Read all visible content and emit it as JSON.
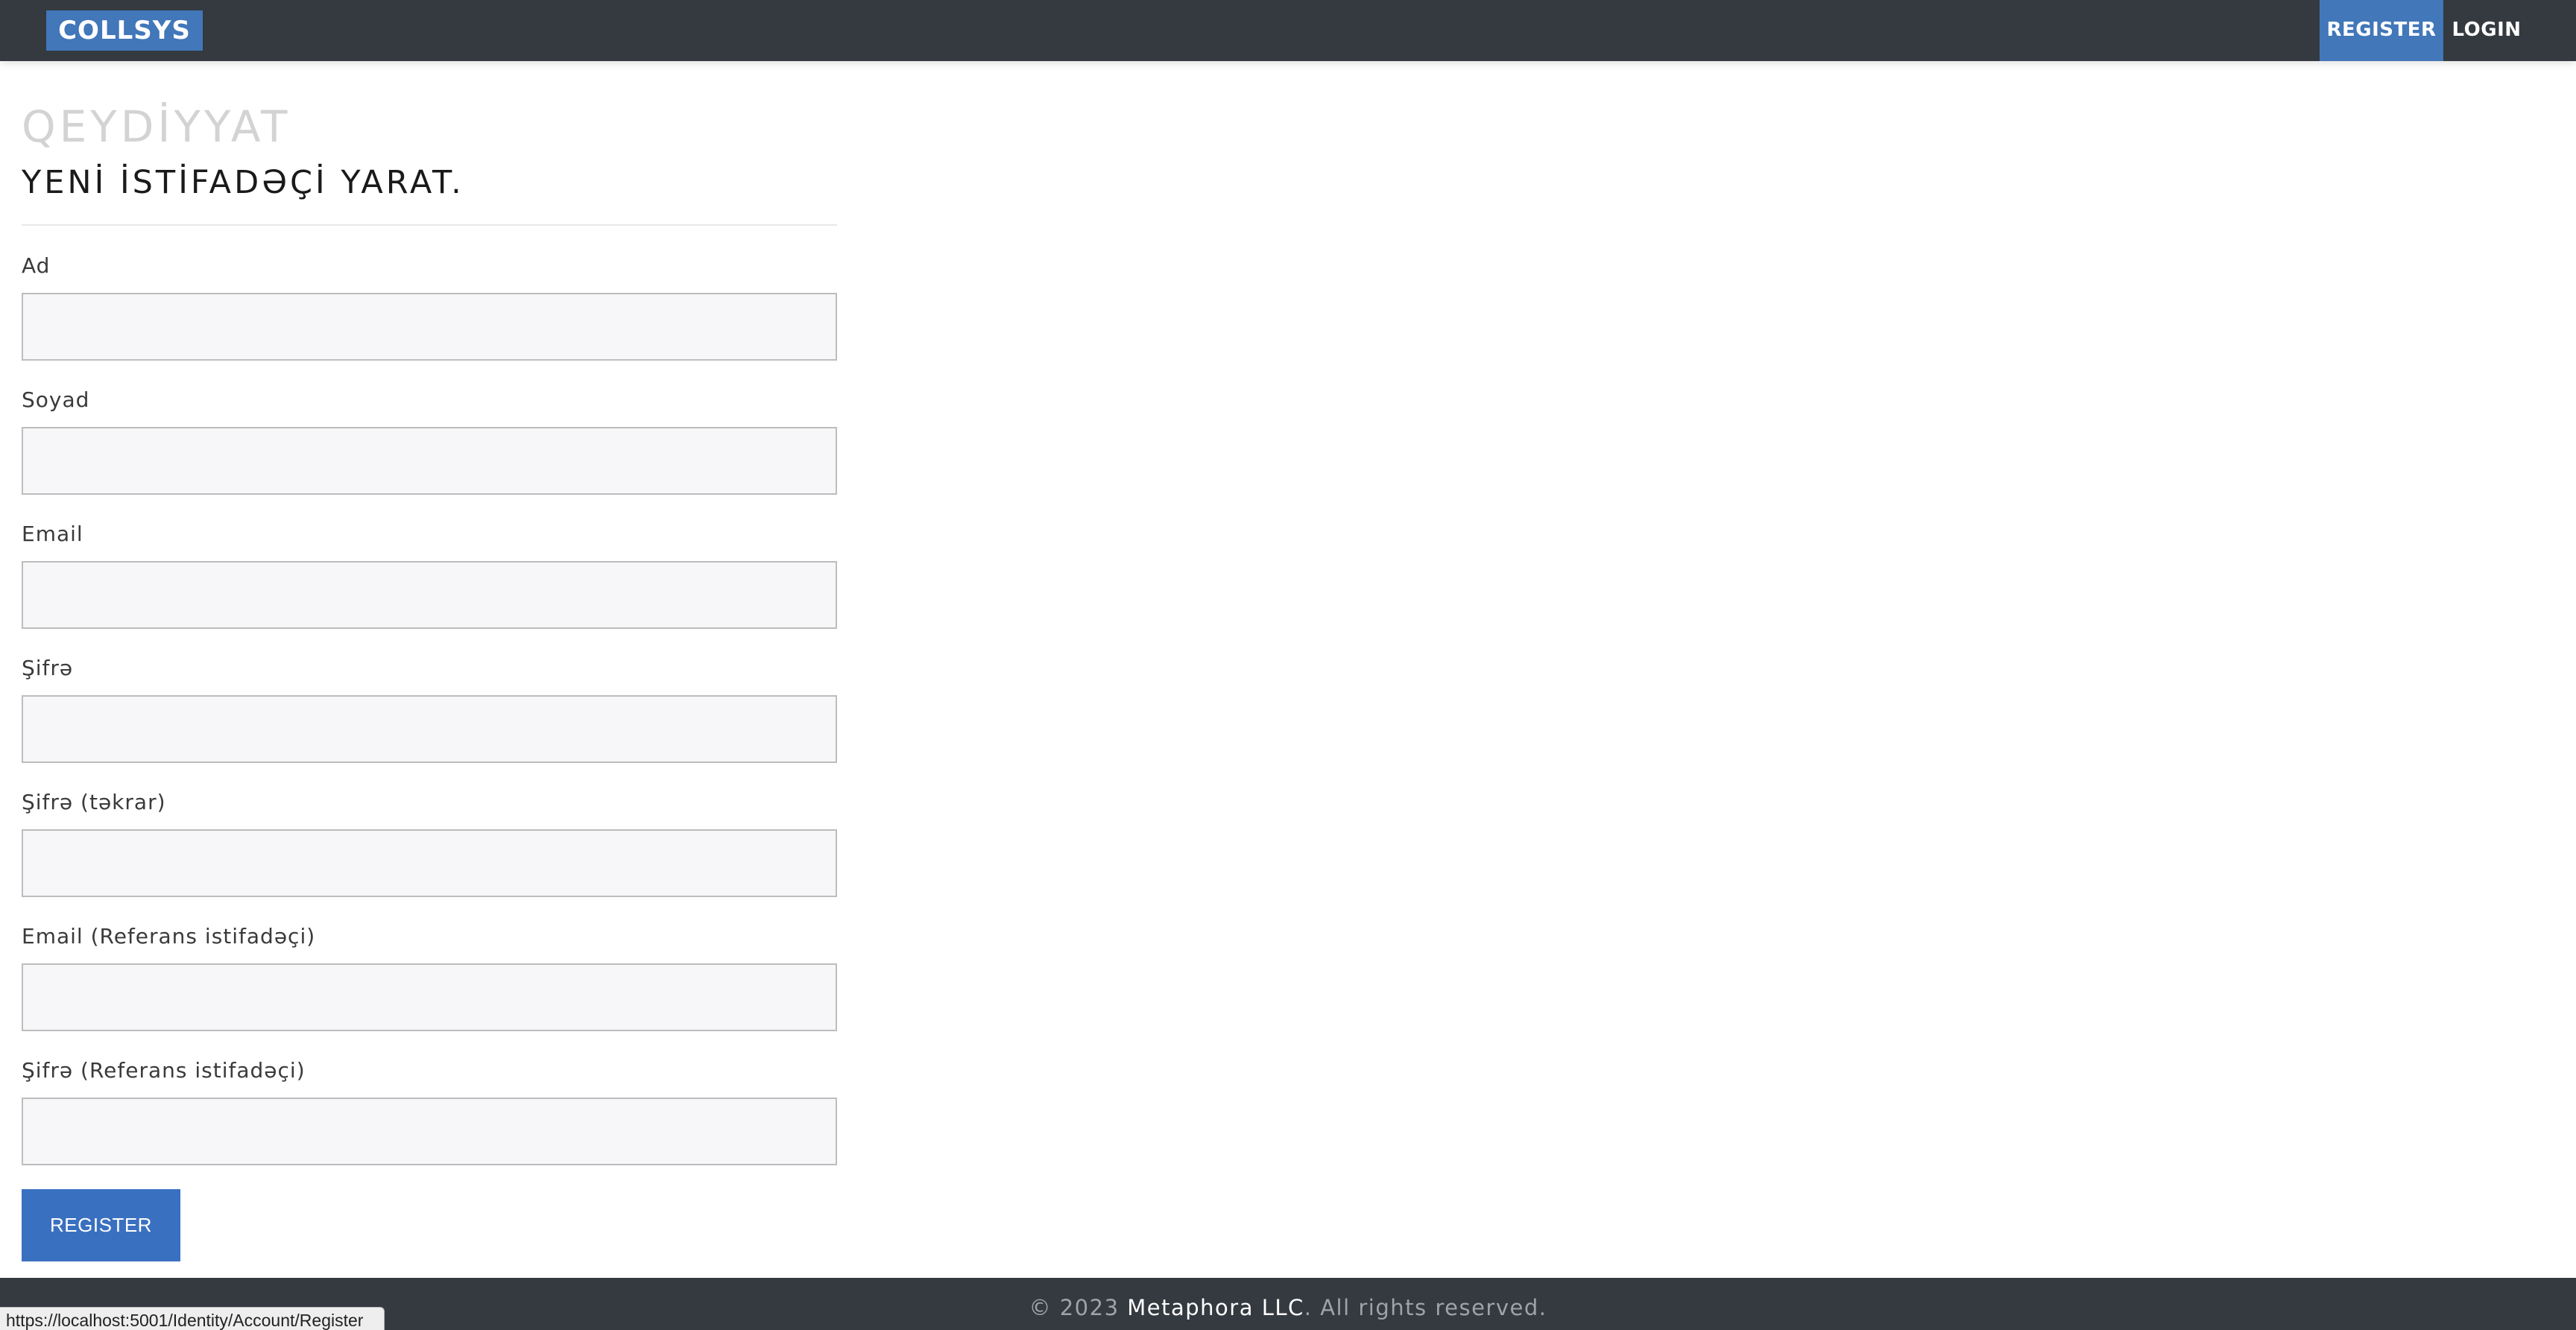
{
  "navbar": {
    "brand": "COLLSYS",
    "links": {
      "register": "REGISTER",
      "login": "LOGIN"
    }
  },
  "page": {
    "title": "QEYDİYYAT",
    "subtitle": "YENİ İSTİFADƏÇİ YARAT."
  },
  "form": {
    "fields": [
      {
        "label": "Ad",
        "value": ""
      },
      {
        "label": "Soyad",
        "value": ""
      },
      {
        "label": "Email",
        "value": ""
      },
      {
        "label": "Şifrə",
        "value": ""
      },
      {
        "label": "Şifrə (təkrar)",
        "value": ""
      },
      {
        "label": "Email (Referans istifadəçi)",
        "value": ""
      },
      {
        "label": "Şifrə (Referans istifadəçi)",
        "value": ""
      }
    ],
    "submit_label": "REGISTER"
  },
  "footer": {
    "prefix": "© 2023 ",
    "company": "Metaphora LLC",
    "suffix": ". All rights reserved."
  },
  "status_bar": {
    "url": "https://localhost:5001/Identity/Account/Register"
  },
  "colors": {
    "navbar_bg": "#343a40",
    "accent": "#4277b9",
    "button": "#3a70c0"
  }
}
